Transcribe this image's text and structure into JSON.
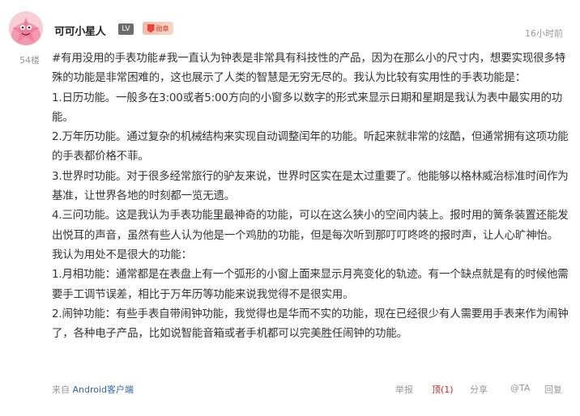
{
  "post": {
    "author": {
      "name": "可可小星人",
      "level_badge": "LV",
      "medal_text": "勋章"
    },
    "time": "16小时前",
    "floor": "54楼",
    "paragraphs": [
      "#有用没用的手表功能#我一直认为钟表是非常具有科技性的产品，因为在那么小的尺寸内，想要实现很多特殊的功能是非常困难的，这也展示了人类的智慧是无穷无尽的。我认为比较有实用性的手表功能是：",
      "1.日历功能。一般多在3:00或者5:00方向的小窗多以数字的形式来显示日期和星期是我认为表中最实用的功能。",
      "2.万年历功能。通过复杂的机械结构来实现自动调整闰年的功能。听起来就非常的炫酷，但通常拥有这项功能的手表都价格不菲。",
      "3.世界时功能。对于很多经常旅行的驴友来说，世界时区实在是太过重要了。他能够以格林威治标准时间作为基准，让世界各地的时刻都一览无遗。",
      "4.三问功能。这是我认为手表功能里最神奇的功能，可以在这么狭小的空间内装上。报时用的簧条装置还能发出悦耳的声音，虽然有些人认为他是一个鸡肋的功能，但是每次听到那叮叮咚咚的报时声，让人心旷神怡。",
      "我认为用处不是很大的功能：",
      "1.月相功能：通常都是在表盘上有一个弧形的小窗上面来显示月亮变化的轨迹。有一个缺点就是有的时候他需要手工调节误差，相比于万年历等功能来说我觉得不是很实用。",
      "2.闹钟功能：有些手表自带闹钟功能，我觉得也是华而不实的功能，现在已经很少有人需要用手表来作为闹钟了，各种电子产品，比如说智能音箱或者手机都可以完美胜任闹钟的功能。"
    ],
    "footer": {
      "client_prefix": "来自",
      "client_name": "Android客户端",
      "report": "举报",
      "like": "顶(1)",
      "share": "分享",
      "at": "@TA",
      "reply": "回复"
    }
  }
}
